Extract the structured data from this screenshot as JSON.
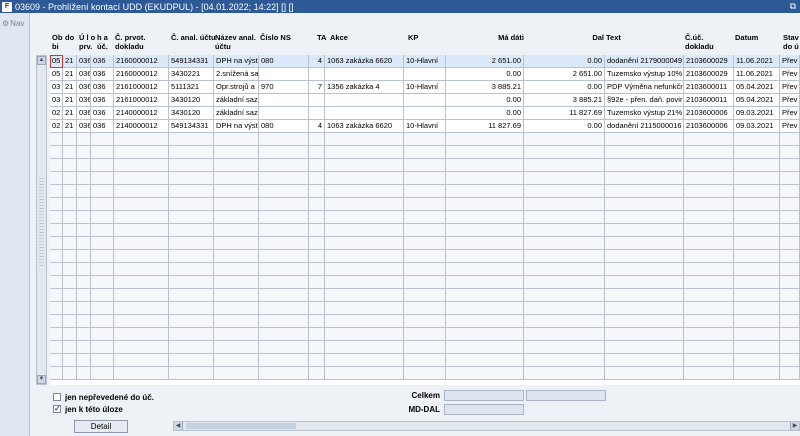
{
  "window": {
    "title": "03609 - Prohlížení kontací UDD (EKUDPUL) - [04.01.2022; 14:22] [] []",
    "app_icon": "F",
    "restore_icon": "restore-icon"
  },
  "nav": {
    "label": "Nav",
    "icon": "gear-icon"
  },
  "columns": [
    {
      "key": "ob",
      "label": "Ob bi"
    },
    {
      "key": "do",
      "label": "do"
    },
    {
      "key": "ulo",
      "label": "Ú l o prv."
    },
    {
      "key": "ha",
      "label": "h a úč."
    },
    {
      "key": "cprvot",
      "label": "Č. prvot. dokladu"
    },
    {
      "key": "canal",
      "label": "Č. anal. účtu"
    },
    {
      "key": "nazev",
      "label": "Název anal. účtu"
    },
    {
      "key": "ns",
      "label": "Číslo NS"
    },
    {
      "key": "ta",
      "label": "TA"
    },
    {
      "key": "akce",
      "label": "Akce"
    },
    {
      "key": "kp",
      "label": "KP"
    },
    {
      "key": "madati",
      "label": "Má dáti"
    },
    {
      "key": "dal",
      "label": "Dal"
    },
    {
      "key": "text",
      "label": "Text"
    },
    {
      "key": "cuc",
      "label": "Č.úč. dokladu"
    },
    {
      "key": "datum",
      "label": "Datum"
    },
    {
      "key": "stav",
      "label": "Stav do ú"
    }
  ],
  "rows": [
    {
      "ob": "05",
      "do": "21",
      "ulo": "036",
      "ha": "036",
      "cprvot": "2160000012",
      "canal": "549134331",
      "nazev": "DPH na výst",
      "ns": "080",
      "ta": "4",
      "akce": "1063 zakázka 6620",
      "kp": "10-Hlavní",
      "madati": "2 651.00",
      "dal": "0.00",
      "text": "dodanění 2179000049",
      "cuc": "2103600029",
      "datum": "11.06.2021",
      "stav": "Přev"
    },
    {
      "ob": "05",
      "do": "21",
      "ulo": "036",
      "ha": "036",
      "cprvot": "2160000012",
      "canal": "3430221",
      "nazev": "2.snížená sa",
      "ns": "",
      "ta": "",
      "akce": "",
      "kp": "",
      "madati": "0.00",
      "dal": "2 651.00",
      "text": "Tuzemsko výstup 10%",
      "cuc": "2103600029",
      "datum": "11.06.2021",
      "stav": "Přev"
    },
    {
      "ob": "03",
      "do": "21",
      "ulo": "036",
      "ha": "036",
      "cprvot": "2161000012",
      "canal": "5111321",
      "nazev": "Opr.strojů a",
      "ns": "970",
      "ta": "7",
      "akce": "1356 zakázka 4",
      "kp": "10-Hlavní",
      "madati": "3 885.21",
      "dal": "0.00",
      "text": "PDP Výměna nefunkčr",
      "cuc": "2103600011",
      "datum": "05.04.2021",
      "stav": "Přev"
    },
    {
      "ob": "03",
      "do": "21",
      "ulo": "036",
      "ha": "036",
      "cprvot": "2161000012",
      "canal": "3430120",
      "nazev": "základní saz",
      "ns": "",
      "ta": "",
      "akce": "",
      "kp": "",
      "madati": "0.00",
      "dal": "3 885.21",
      "text": "§92e - přen. daň. povir",
      "cuc": "2103600011",
      "datum": "05.04.2021",
      "stav": "Přev"
    },
    {
      "ob": "02",
      "do": "21",
      "ulo": "036",
      "ha": "036",
      "cprvot": "2140000012",
      "canal": "3430120",
      "nazev": "základní saz",
      "ns": "",
      "ta": "",
      "akce": "",
      "kp": "",
      "madati": "0.00",
      "dal": "11 827.69",
      "text": "Tuzemsko výstup 21%",
      "cuc": "2103600006",
      "datum": "09.03.2021",
      "stav": "Přev"
    },
    {
      "ob": "02",
      "do": "21",
      "ulo": "036",
      "ha": "036",
      "cprvot": "2140000012",
      "canal": "549134331",
      "nazev": "DPH na výst",
      "ns": "080",
      "ta": "4",
      "akce": "1063 zakázka 6620",
      "kp": "10-Hlavní",
      "madati": "11 827.69",
      "dal": "0.00",
      "text": "dodanění 2115000016",
      "cuc": "2103600006",
      "datum": "09.03.2021",
      "stav": "Přev"
    }
  ],
  "filters": {
    "unposted": {
      "label": "jen nepřevedené do úč.",
      "checked": false
    },
    "this_task": {
      "label": "jen k této úloze",
      "checked": true
    }
  },
  "detail_button": "Detail",
  "totals": {
    "celkem_label": "Celkem",
    "mddal_label": "MD-DAL"
  },
  "scroll": {
    "up_icon": "arrow-up-icon",
    "down_icon": "arrow-down-icon",
    "left_icon": "arrow-left-icon",
    "right_icon": "arrow-right-icon"
  }
}
